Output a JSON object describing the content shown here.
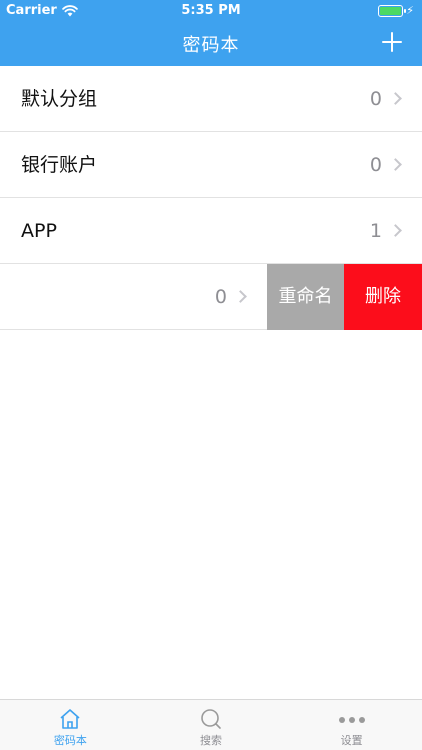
{
  "status_bar": {
    "carrier": "Carrier",
    "time": "5:35 PM",
    "battery_color": "#4cd964"
  },
  "nav": {
    "title": "密码本",
    "add_icon": "plus-icon",
    "background": "#3ea2ef"
  },
  "groups": [
    {
      "name": "默认分组",
      "count": "0"
    },
    {
      "name": "银行账户",
      "count": "0"
    },
    {
      "name": "APP",
      "count": "1"
    },
    {
      "name": "",
      "count": "0"
    }
  ],
  "swipe_actions": {
    "rename_label": "重命名",
    "delete_label": "删除",
    "rename_color": "#a9a9a9",
    "delete_color": "#fc0d1b"
  },
  "tabbar": {
    "tabs": [
      {
        "label": "密码本",
        "icon": "home-icon",
        "active": true
      },
      {
        "label": "搜索",
        "icon": "search-icon",
        "active": false
      },
      {
        "label": "设置",
        "icon": "more-icon",
        "active": false
      }
    ],
    "active_color": "#3ea2ef"
  }
}
